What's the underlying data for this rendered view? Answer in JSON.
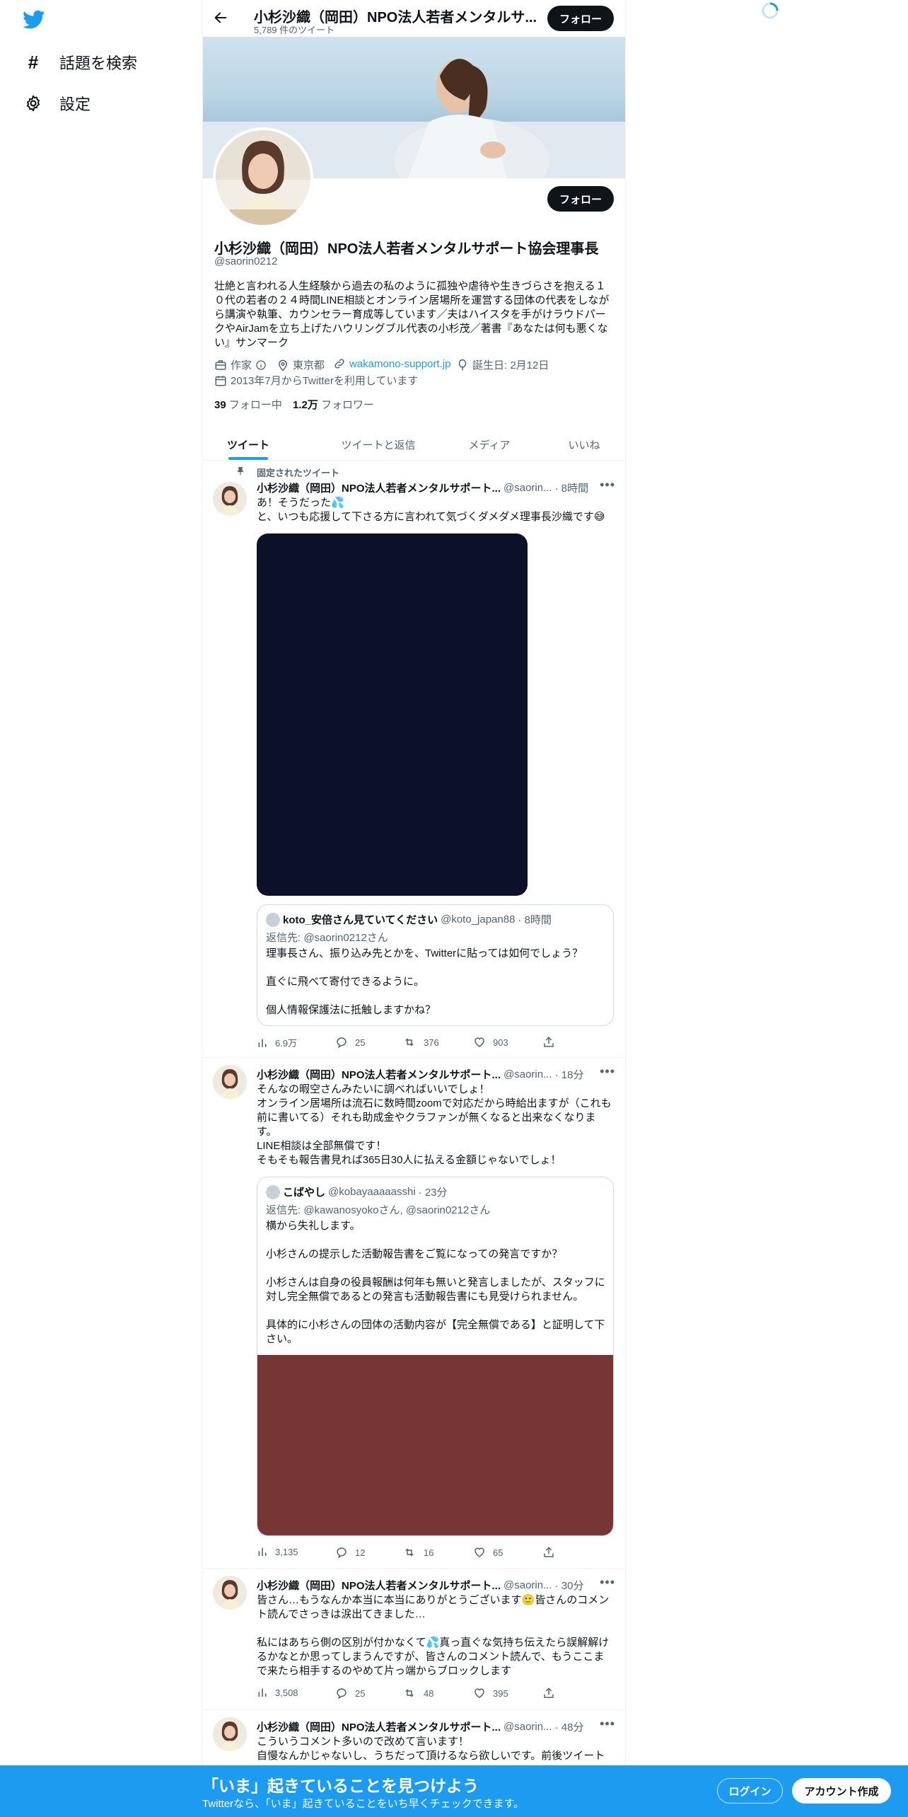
{
  "colors": {
    "accent": "#1d9bf0",
    "text": "#0f1419",
    "secondary": "#536471",
    "dark_button": "#0f1419"
  },
  "sidebar": {
    "logo_icon": "twitter-bird-icon",
    "items": [
      {
        "icon": "hashtag-icon",
        "label": "話題を検索"
      },
      {
        "icon": "gear-icon",
        "label": "設定"
      }
    ]
  },
  "header": {
    "back_icon": "arrow-left-icon",
    "title": "小杉沙織（岡田）NPO法人若者メンタルサ...",
    "tweet_count": "5,789 件のツイート",
    "follow_label": "フォロー"
  },
  "profile": {
    "follow_label": "フォロー",
    "name": "小杉沙織（岡田）NPO法人若者メンタルサポート協会理事長",
    "handle": "@saorin0212",
    "bio": "壮絶と言われる人生経験から過去の私のように孤独や虐待や生きづらさを抱える１０代の若者の２４時間LINE相談とオンライン居場所を運営する団体の代表をしながら講演や執筆、カウンセラー育成等しています／夫はハイスタを手がけラウドパークやAirJamを立ち上げたハウリングブル代表の小杉茂／著書『あなたは何も悪くない』サンマーク",
    "category": "作家",
    "location": "東京都",
    "website": "wakamono-support.jp",
    "birthday": "誕生日: 2月12日",
    "joined": "2013年7月からTwitterを利用しています",
    "following_count": "39",
    "following_label": "フォロー中",
    "followers_count": "1.2万",
    "followers_label": "フォロワー"
  },
  "tabs": [
    {
      "label": "ツイート",
      "active": true
    },
    {
      "label": "ツイートと返信",
      "active": false
    },
    {
      "label": "メディア",
      "active": false
    },
    {
      "label": "いいね",
      "active": false
    }
  ],
  "tweets": [
    {
      "pinned_label": "固定されたツイート",
      "name": "小杉沙織（岡田）NPO法人若者メンタルサポート...",
      "handle": "@saorin...",
      "time": "· 8時間",
      "text": "あ！そうだった💦\nと、いつも応援して下さる方に言われて気づくダメダメ理事長沙織です😅",
      "quote": {
        "name": "koto_安倍さん見ていてください",
        "handle": "@koto_japan88",
        "time": "· 8時間",
        "reply_to": "返信先: @saorin0212さん",
        "text": "理事長さん、振り込み先とかを、Twitterに貼っては如何でしょう？\n\n直ぐに飛べて寄付できるように。\n\n個人情報保護法に抵触しますかね？"
      },
      "stats": {
        "views": "6.9万",
        "replies": "25",
        "retweets": "376",
        "likes": "903"
      }
    },
    {
      "name": "小杉沙織（岡田）NPO法人若者メンタルサポート...",
      "handle": "@saorin...",
      "time": "· 18分",
      "text": "そんなの暇空さんみたいに調べればいいでしょ！\nオンライン居場所は流石に数時間zoomで対応だから時給出ますが（これも前に書いてる）それも助成金やクラファンが無くなると出来なくなります。\nLINE相談は全部無償です！\nそもそも報告書見れば365日30人に払える金額じゃないでしょ！",
      "quote": {
        "name": "こばやし",
        "handle": "@kobayaaaaasshi",
        "time": "· 23分",
        "reply_to": "返信先: @kawanosyokoさん, @saorin0212さん",
        "text": "横から失礼します。\n\n小杉さんの提示した活動報告書をご覧になっての発言ですか？\n\n小杉さんは自身の役員報酬は何年も無いと発言しましたが、スタッフに対し完全無償であるとの発言も活動報告書にも見受けられません。\n\n具体的に小杉さんの団体の活動内容が【完全無償である】と証明して下さい。"
      },
      "stats": {
        "views": "3,135",
        "replies": "12",
        "retweets": "16",
        "likes": "65"
      }
    },
    {
      "name": "小杉沙織（岡田）NPO法人若者メンタルサポート...",
      "handle": "@saorin...",
      "time": "· 30分",
      "text": "皆さん…もうなんか本当に本当にありがとうございます🙂皆さんのコメント読んでさっきは涙出てきました…\n\n私にはあちら側の区別が付かなくて💦真っ直ぐな気持ち伝えたら誤解解けるかなとか思ってしまうんですが、皆さんのコメント読んで、もうここまで来たら相手するのやめて片っ端からブロックします",
      "stats": {
        "views": "3,508",
        "replies": "25",
        "retweets": "48",
        "likes": "395"
      }
    },
    {
      "name": "小杉沙織（岡田）NPO法人若者メンタルサポート...",
      "handle": "@saorin...",
      "time": "· 48分",
      "text": "こういうコメント多いので改めて言います！\n自慢なんかじゃないし、うちだって頂けるなら欲しいです。前後ツイート"
    }
  ],
  "bottom_bar": {
    "headline": "「いま」起きていることを見つけよう",
    "subtext": "Twitterなら、「いま」起きていることをいち早くチェックできます。",
    "login_label": "ログイン",
    "signup_label": "アカウント作成"
  }
}
